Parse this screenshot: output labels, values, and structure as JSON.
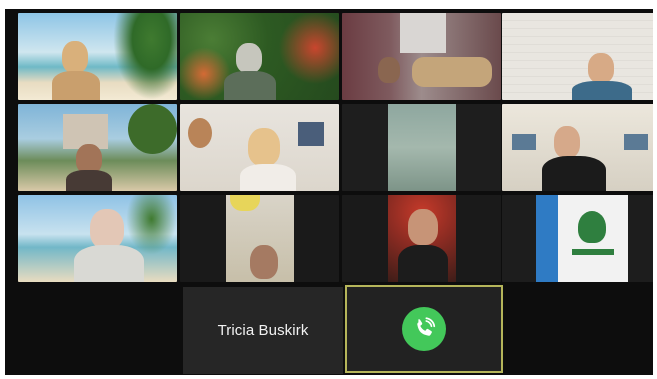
{
  "gallery": {
    "participants": [
      {
        "icon": "participant-video-beach"
      },
      {
        "icon": "participant-video-garden"
      },
      {
        "icon": "participant-video-living-room"
      },
      {
        "icon": "participant-video-white-wall"
      },
      {
        "icon": "participant-video-resort"
      },
      {
        "icon": "participant-video-kitchen"
      },
      {
        "icon": "participant-video-dim-room"
      },
      {
        "icon": "participant-video-office"
      },
      {
        "icon": "participant-video-beach-2"
      },
      {
        "icon": "participant-video-cropped"
      },
      {
        "icon": "participant-video-red-background"
      },
      {
        "icon": "participant-video-girl-scouts-logo"
      }
    ],
    "audio_only_participant": {
      "name": "Tricia Buskirk"
    },
    "phone_participant": {
      "icon": "phone-call-icon",
      "accent": "#43c85a",
      "highlight": "#b5b55a"
    }
  }
}
